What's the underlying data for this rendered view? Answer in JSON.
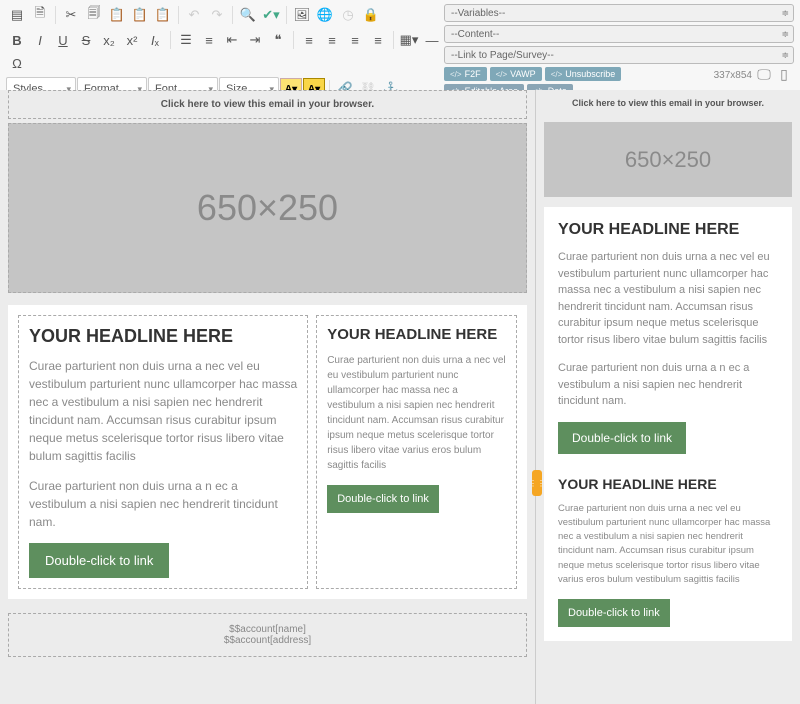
{
  "dropdowns": {
    "variables": "--Variables--",
    "content": "--Content--",
    "linkto": "--Link to Page/Survey--",
    "styles": "Styles",
    "format": "Format",
    "font": "Font",
    "size": "Size"
  },
  "tags": [
    "F2F",
    "VAWP",
    "Unsubscribe",
    "Editable Area",
    "Date"
  ],
  "dimensions": "337x854",
  "editor": {
    "viewLink": "Click here to view this email in your browser.",
    "hero": "650×250",
    "col1": {
      "headline": "YOUR HEADLINE HERE",
      "p1": "Curae parturient non duis urna a nec vel eu vestibulum parturient nunc ullamcorper hac massa nec a vestibulum a nisi sapien nec hendrerit tincidunt nam. Accumsan risus curabitur ipsum neque metus scelerisque tortor risus libero vitae bulum sagittis facilis",
      "p2": "Curae parturient non duis urna a n ec a vestibulum a nisi sapien nec hendrerit tincidunt nam.",
      "cta": "Double-click to link"
    },
    "col2": {
      "headline": "YOUR HEADLINE HERE",
      "p1": "Curae parturient non duis urna a nec vel eu vestibulum parturient nunc ullamcorper hac massa nec a vestibulum a nisi sapien nec hendrerit tincidunt nam. Accumsan risus curabitur ipsum neque metus scelerisque tortor risus libero vitae varius eros bulum sagittis facilis",
      "cta": "Double-click to link"
    },
    "footer1": "$$account[name]",
    "footer2": "$$account[address]"
  },
  "preview": {
    "viewLink": "Click here to view this email in your browser.",
    "hero": "650×250",
    "block1": {
      "headline": "YOUR HEADLINE HERE",
      "p1": "Curae parturient non duis urna a nec vel eu vestibulum parturient nunc ullamcorper hac massa nec a vestibulum a nisi sapien nec hendrerit tincidunt nam. Accumsan risus curabitur ipsum neque metus scelerisque tortor risus libero vitae bulum sagittis facilis",
      "p2": "Curae parturient non duis urna a n ec a vestibulum a nisi sapien nec hendrerit tincidunt nam.",
      "cta": "Double-click to link"
    },
    "block2": {
      "headline": "YOUR HEADLINE HERE",
      "p1": "Curae parturient non duis urna a nec vel eu vestibulum parturient nunc ullamcorper hac massa nec a vestibulum a nisi sapien nec hendrerit tincidunt nam. Accumsan risus curabitur ipsum neque metus scelerisque tortor risus libero vitae varius eros bulum vestibulum sagittis facilis",
      "cta": "Double-click to link"
    }
  }
}
